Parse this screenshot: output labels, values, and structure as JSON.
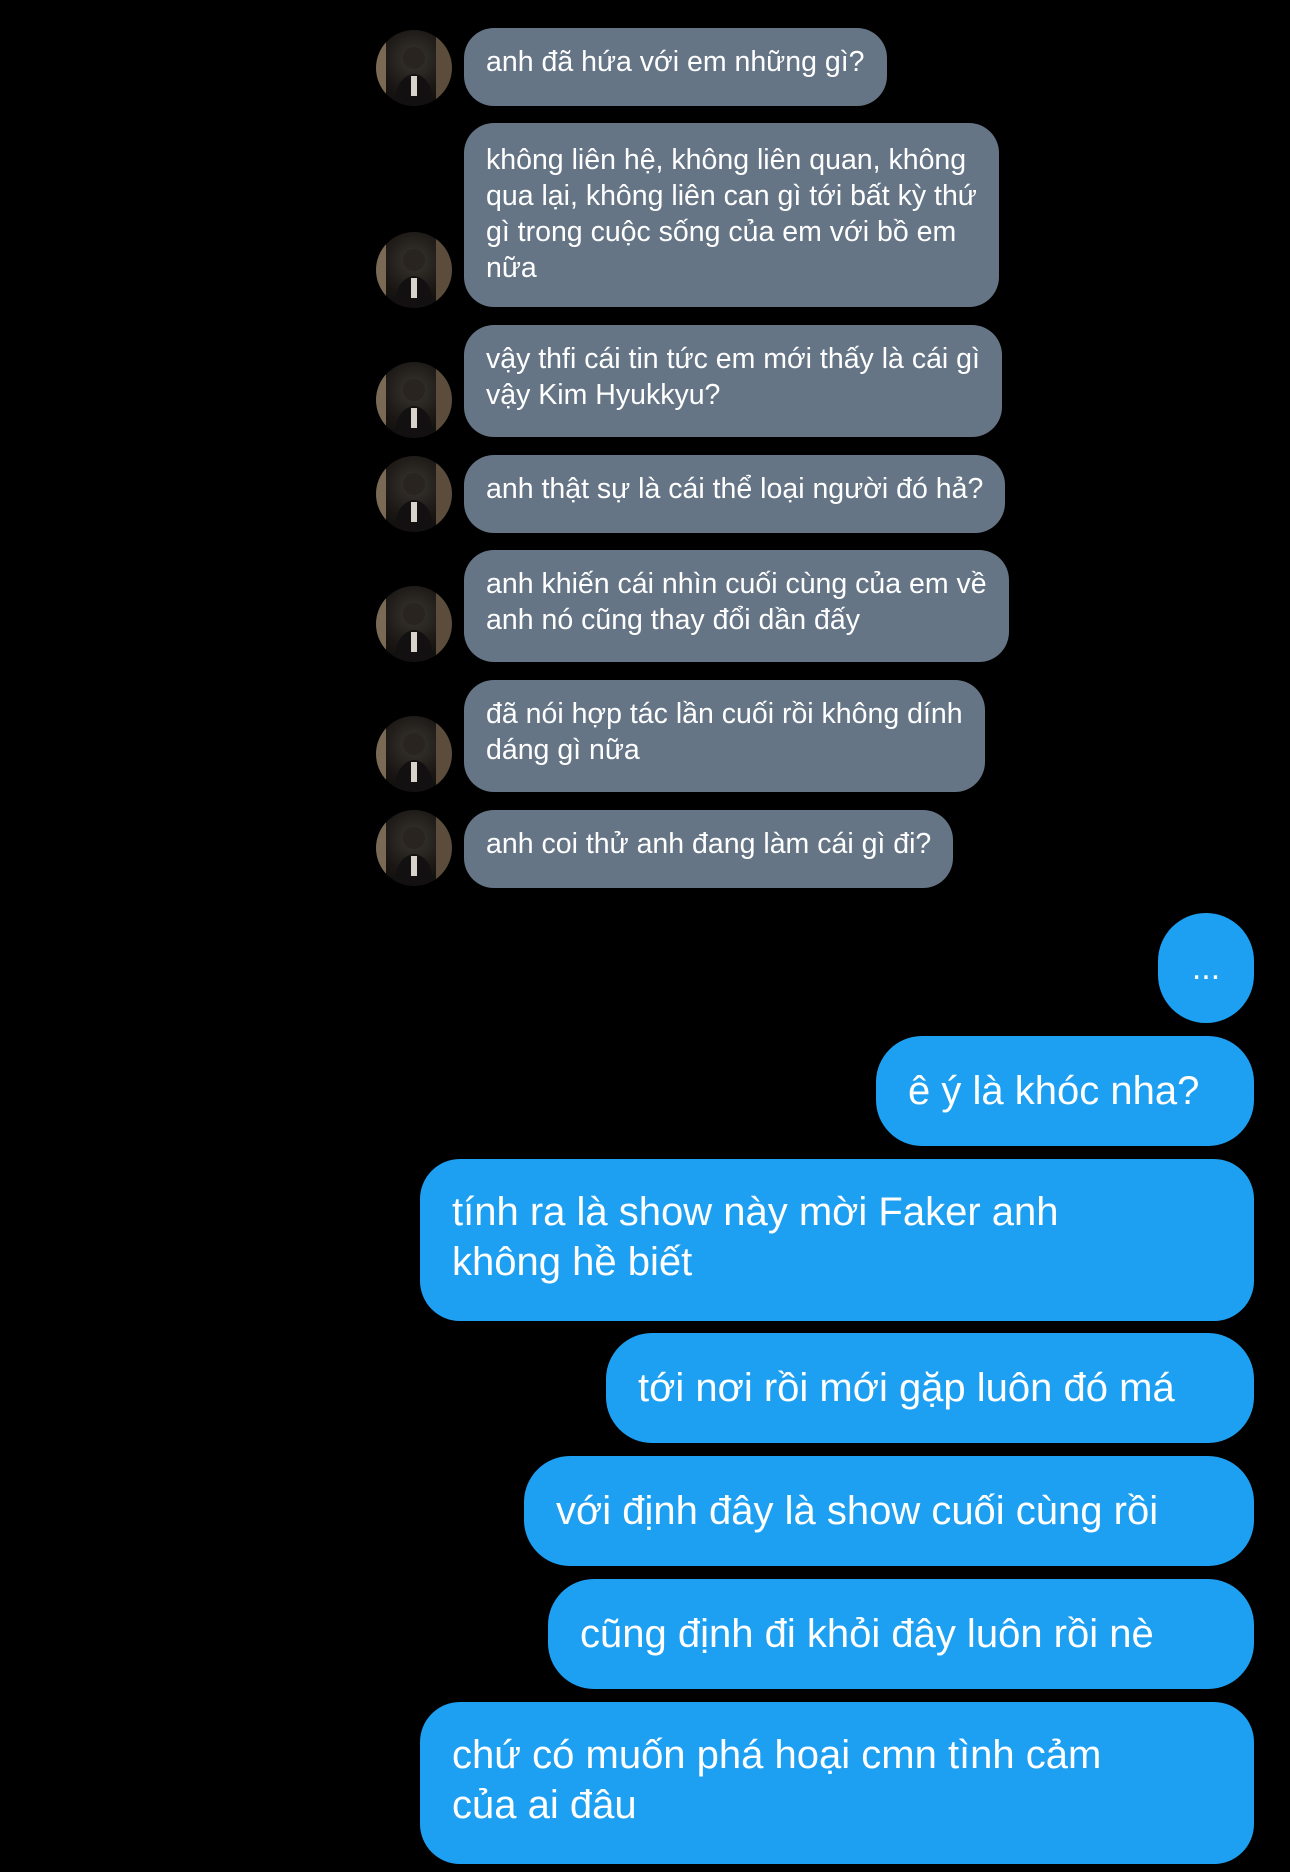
{
  "conversation": {
    "incoming": [
      {
        "text": "anh đã hứa với em những gì?"
      },
      {
        "text": "không liên hệ, không liên quan, không\nqua lại, không liên can gì tới bất kỳ thứ\ngì trong cuộc sống của em với bồ em\nnữa"
      },
      {
        "text": "vậy thfi cái tin tức em mới thấy là cái gì\nvậy Kim Hyukkyu?"
      },
      {
        "text": "anh thật sự là cái thể loại người đó hả?"
      },
      {
        "text": "anh khiến cái nhìn cuối cùng của em về\nanh nó cũng thay đổi dần đấy"
      },
      {
        "text": "đã nói hợp tác lần cuối rồi không dính\ndáng gì nữa"
      },
      {
        "text": "anh coi thử anh đang làm cái gì đi?"
      }
    ],
    "outgoing": [
      {
        "text": "..."
      },
      {
        "text": "ê ý là khóc nha?"
      },
      {
        "text": "tính ra là show này mời Faker anh\nkhông hề biết"
      },
      {
        "text": "tới nơi rồi mới gặp luôn đó má"
      },
      {
        "text": "với định đây là show cuối cùng rồi"
      },
      {
        "text": "cũng định đi khỏi đây luôn rồi nè"
      },
      {
        "text": "chứ có muốn phá hoại cmn tình cảm\ncủa ai đâu"
      }
    ]
  },
  "colors": {
    "background": "#000000",
    "incoming_bubble": "#657586",
    "outgoing_bubble": "#1ea0f2",
    "text": "#ffffff"
  },
  "icons": {
    "avatar": "profile-photo-icon"
  }
}
